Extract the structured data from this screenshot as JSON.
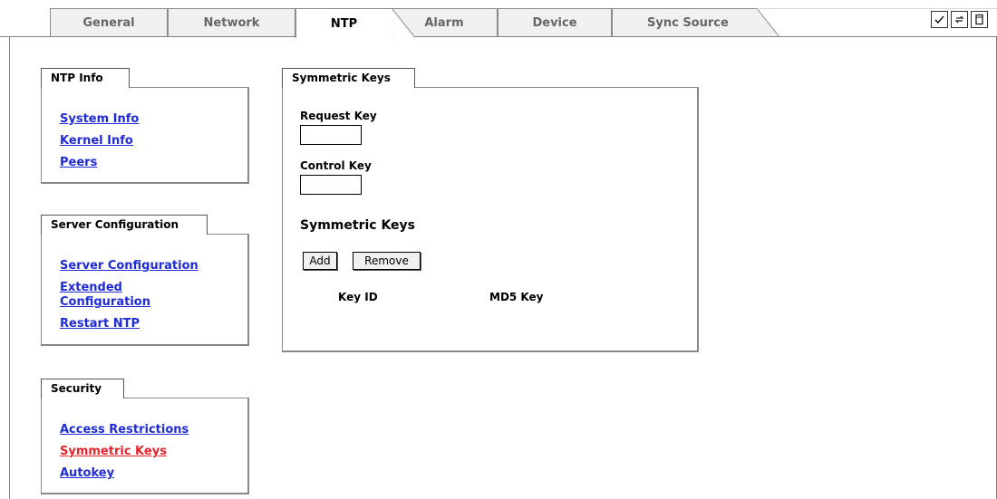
{
  "tabs": [
    {
      "label": "General"
    },
    {
      "label": "Network"
    },
    {
      "label": "NTP"
    },
    {
      "label": "Alarm"
    },
    {
      "label": "Device"
    },
    {
      "label": "Sync Source"
    }
  ],
  "active_tab": "NTP",
  "toolbar_icons": [
    "check-icon",
    "swap-icon",
    "page-icon"
  ],
  "ntp_info": {
    "title": "NTP Info",
    "links": [
      "System Info",
      "Kernel Info",
      "Peers"
    ]
  },
  "server_config": {
    "title": "Server Configuration",
    "links": [
      "Server Configuration",
      "Extended Configuration",
      "Restart NTP"
    ]
  },
  "security": {
    "title": "Security",
    "links": [
      "Access Restrictions",
      "Symmetric Keys",
      "Autokey"
    ],
    "current": "Symmetric Keys"
  },
  "symmetric": {
    "title": "Symmetric Keys",
    "request_key_label": "Request Key",
    "request_key_value": "",
    "control_key_label": "Control Key",
    "control_key_value": "",
    "section_heading": "Symmetric Keys",
    "add_label": "Add",
    "remove_label": "Remove",
    "col_key_id": "Key ID",
    "col_md5": "MD5 Key"
  },
  "colors": {
    "link": "#1f2bd6",
    "link_current": "#e8232b"
  }
}
